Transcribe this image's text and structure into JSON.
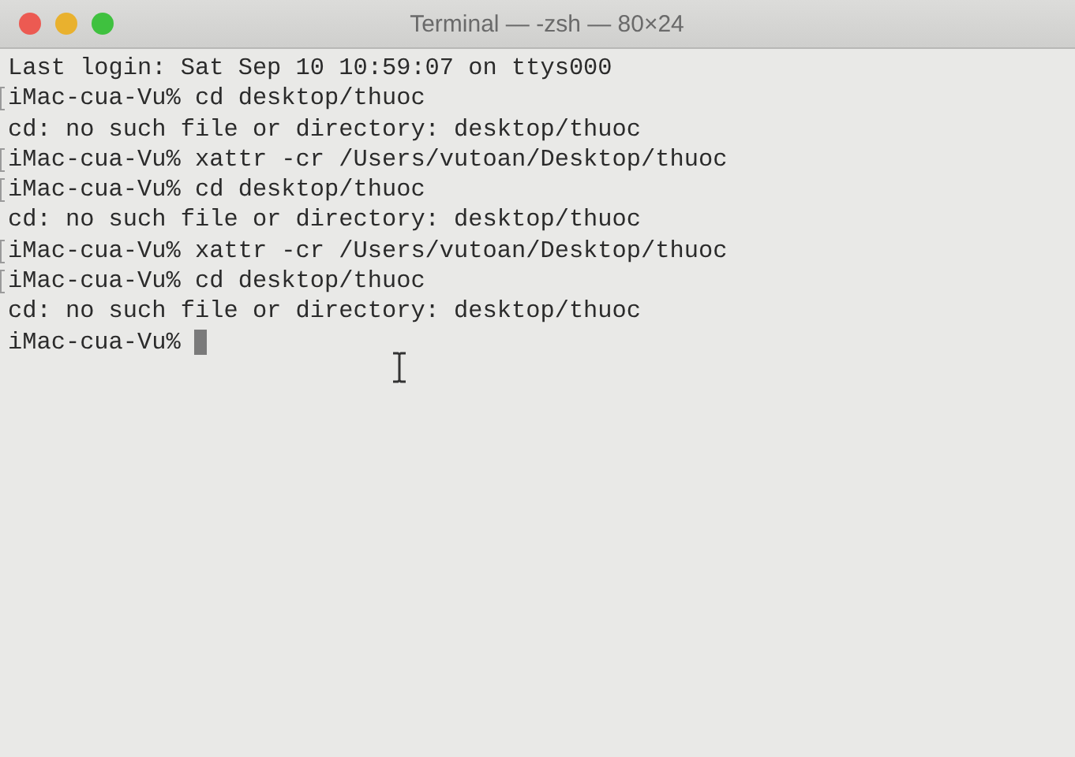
{
  "window": {
    "title": "Terminal — -zsh — 80×24"
  },
  "lines": [
    {
      "text": "Last login: Sat Sep 10 10:59:07 on ttys000",
      "marked": false
    },
    {
      "text": "iMac-cua-Vu% cd desktop/thuoc",
      "marked": true
    },
    {
      "text": "cd: no such file or directory: desktop/thuoc",
      "marked": false
    },
    {
      "text": "iMac-cua-Vu% xattr -cr /Users/vutoan/Desktop/thuoc",
      "marked": true
    },
    {
      "text": "iMac-cua-Vu% cd desktop/thuoc",
      "marked": true
    },
    {
      "text": "cd: no such file or directory: desktop/thuoc",
      "marked": false
    },
    {
      "text": "iMac-cua-Vu% xattr -cr /Users/vutoan/Desktop/thuoc",
      "marked": true
    },
    {
      "text": "iMac-cua-Vu% cd desktop/thuoc",
      "marked": true
    },
    {
      "text": "cd: no such file or directory: desktop/thuoc",
      "marked": false
    }
  ],
  "prompt": {
    "text": "iMac-cua-Vu% ",
    "marked": false
  }
}
